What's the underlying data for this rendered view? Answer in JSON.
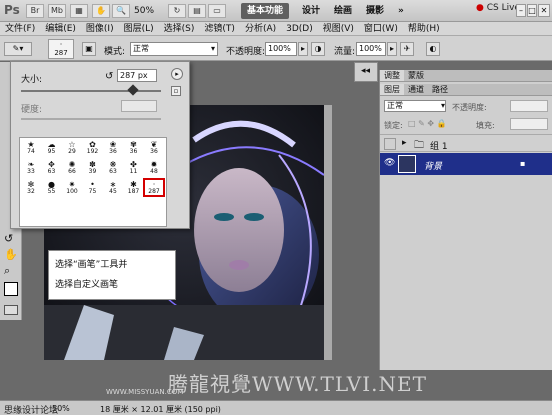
{
  "topbar": {
    "logo": "Ps",
    "zoom": "50%",
    "workspaces": [
      "基本功能",
      "设计",
      "绘画",
      "摄影"
    ],
    "workspace_more": "»",
    "cs_live": "CS Live",
    "win_buttons": [
      "–",
      "□",
      "✕"
    ]
  },
  "menubar": {
    "items": [
      "文件(F)",
      "编辑(E)",
      "图像(I)",
      "图层(L)",
      "选择(S)",
      "滤镜(T)",
      "分析(A)",
      "3D(D)",
      "视图(V)",
      "窗口(W)",
      "帮助(H)"
    ]
  },
  "options": {
    "brush_size": "287",
    "mode_label": "模式:",
    "mode_value": "正常",
    "opacity_label": "不透明度:",
    "opacity_value": "100%",
    "flow_label": "流量:",
    "flow_value": "100%"
  },
  "brush_popup": {
    "size_label": "大小:",
    "size_value": "287 px",
    "hardness_label": "硬度:",
    "brushes": [
      {
        "glyph": "★",
        "num": "74"
      },
      {
        "glyph": "☁",
        "num": "95"
      },
      {
        "glyph": "☆",
        "num": "29"
      },
      {
        "glyph": "✿",
        "num": "192"
      },
      {
        "glyph": "❀",
        "num": "36"
      },
      {
        "glyph": "✾",
        "num": "36"
      },
      {
        "glyph": "❦",
        "num": "36"
      },
      {
        "glyph": "❧",
        "num": "33"
      },
      {
        "glyph": "✥",
        "num": "63"
      },
      {
        "glyph": "✺",
        "num": "66"
      },
      {
        "glyph": "✽",
        "num": "39"
      },
      {
        "glyph": "❋",
        "num": "63"
      },
      {
        "glyph": "✤",
        "num": "11"
      },
      {
        "glyph": "✹",
        "num": "48"
      },
      {
        "glyph": "✻",
        "num": "32"
      },
      {
        "glyph": "●",
        "num": "55"
      },
      {
        "glyph": "✷",
        "num": "100"
      },
      {
        "glyph": "•",
        "num": "75"
      },
      {
        "glyph": "∗",
        "num": "45"
      },
      {
        "glyph": "✱",
        "num": "187"
      },
      {
        "glyph": "·",
        "num": "287"
      }
    ]
  },
  "instruction": {
    "line1": "选择“画笔”工具并",
    "line2": "选择自定义画笔"
  },
  "panels": {
    "top_tabs": [
      "调整",
      "蒙版"
    ],
    "layer_tabs": [
      "图层",
      "通道",
      "路径"
    ],
    "blend_mode": "正常",
    "opacity_label": "不透明度:",
    "lock_label": "锁定:",
    "fill_label": "填充:",
    "group_name": "组 1",
    "bg_layer_name": "背景"
  },
  "statusbar": {
    "zoom": "50%",
    "docinfo": "18 厘米 × 12.01 厘米 (150 ppi)"
  },
  "watermark": {
    "site1": "思缘设计论坛",
    "site2": "WWW.MISSYUAN.COM",
    "brand": "腾龍視覺WWW.TLVI.NET"
  },
  "colors": {
    "accent_selected": "#1f2f8a",
    "highlight_red": "#d40000"
  }
}
